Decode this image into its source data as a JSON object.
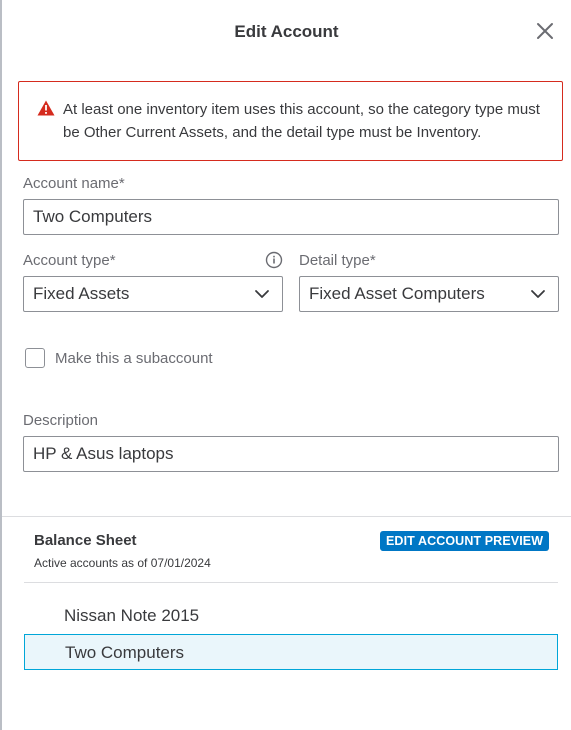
{
  "header": {
    "title": "Edit Account"
  },
  "alert": {
    "text": "At least one inventory item uses this account, so the category type must be Other Current Assets, and the detail type must be Inventory."
  },
  "form": {
    "account_name": {
      "label": "Account name*",
      "value": "Two Computers"
    },
    "account_type": {
      "label": "Account type*",
      "value": "Fixed Assets"
    },
    "detail_type": {
      "label": "Detail type*",
      "value": "Fixed Asset Computers"
    },
    "subaccount": {
      "label": "Make this a subaccount",
      "checked": false
    },
    "description": {
      "label": "Description",
      "value": "HP & Asus laptops"
    }
  },
  "preview": {
    "title": "Balance Sheet",
    "subtitle": "Active accounts as of 07/01/2024",
    "badge": "EDIT ACCOUNT PREVIEW",
    "items": [
      "Nissan Note 2015",
      "Two Computers"
    ]
  },
  "colors": {
    "alert": "#d52b1e",
    "accent": "#0077c5",
    "selected_bg": "#eaf6fb",
    "selected_border": "#00a6d8"
  },
  "icons": {
    "close": "close-icon",
    "warning": "warning-icon",
    "info": "info-icon",
    "chevron": "chevron-down-icon"
  }
}
